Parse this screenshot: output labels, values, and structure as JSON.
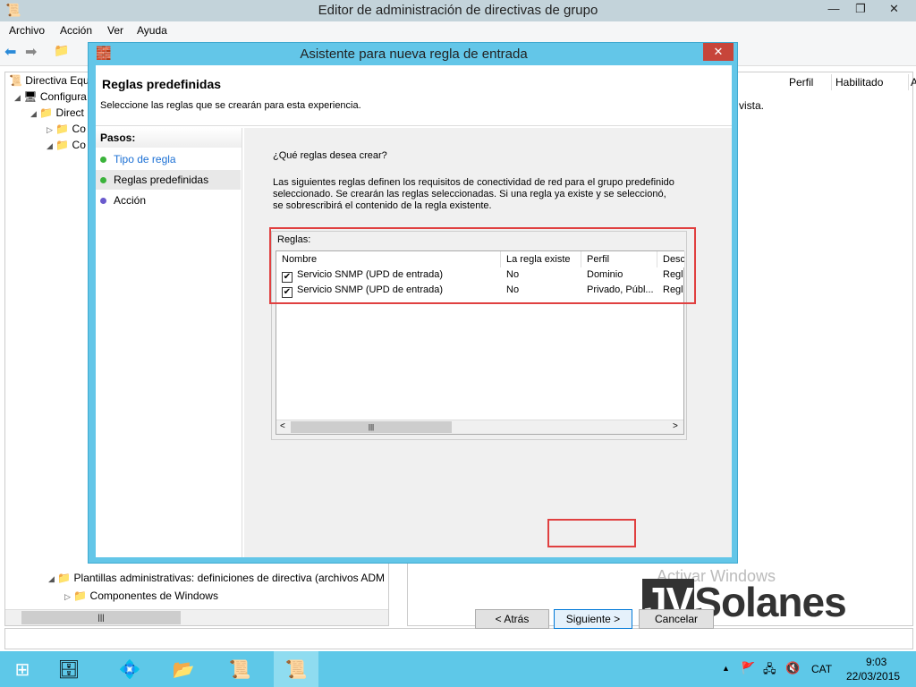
{
  "window": {
    "title": "Editor de administración de directivas de grupo",
    "minimize": "—",
    "restore": "❐",
    "close": "✕"
  },
  "menu": [
    "Archivo",
    "Acción",
    "Ver",
    "Ayuda"
  ],
  "tree": {
    "items": [
      "Directiva Equ",
      "Configura",
      "Direct",
      "Co",
      "Co",
      "Plantillas administrativas: definiciones de directiva (archivos ADM",
      "Componentes de Windows"
    ]
  },
  "right_pane": {
    "columns": [
      "Perfil",
      "Habilitado",
      "A"
    ],
    "text": "vista."
  },
  "dialog": {
    "title": "Asistente para nueva regla de entrada",
    "close": "✕",
    "header_title": "Reglas predefinidas",
    "header_subtitle": "Seleccione las reglas que se crearán para esta experiencia.",
    "steps_label": "Pasos:",
    "steps": [
      {
        "label": "Tipo de regla",
        "color": "#3bb33b",
        "link": true
      },
      {
        "label": "Reglas predefinidas",
        "color": "#3bb33b",
        "current": true
      },
      {
        "label": "Acción",
        "color": "#6a5acd"
      }
    ],
    "question": "¿Qué reglas desea crear?",
    "description": "Las siguientes reglas definen los requisitos de conectividad de red para el grupo predefinido seleccionado. Se crearán las reglas seleccionadas. Si una regla ya existe y se seleccionó, se sobrescribirá el contenido de la regla existente.",
    "rules_label": "Reglas:",
    "columns": [
      "Nombre",
      "La regla existe",
      "Perfil",
      "Desc"
    ],
    "rows": [
      {
        "checked": true,
        "name": "Servicio SNMP (UPD de entrada)",
        "exists": "No",
        "profile": "Dominio",
        "desc": "Regla"
      },
      {
        "checked": true,
        "name": "Servicio SNMP (UPD de entrada)",
        "exists": "No",
        "profile": "Privado, Públ...",
        "desc": "Regla"
      }
    ],
    "back": "< Atrás",
    "next": "Siguiente >",
    "cancel": "Cancelar"
  },
  "watermark": {
    "activate": "Activar Windows",
    "logo": "JVSolanes"
  },
  "taskbar": {
    "tray_arrow": "▲",
    "language": "CAT",
    "time": "9:03",
    "date": "22/03/2015"
  },
  "colors": {
    "accent": "#63c6e8",
    "highlight": "#e04040"
  }
}
